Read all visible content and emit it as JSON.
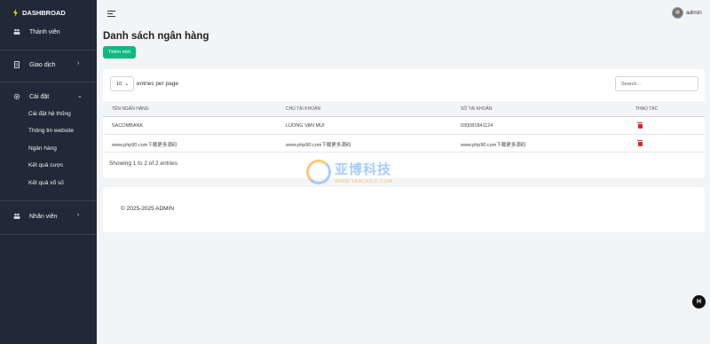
{
  "sidebar": {
    "brand": "DASHBROAD",
    "items": [
      {
        "label": "Thành viên",
        "icon": "users-icon"
      },
      {
        "label": "Giao dịch",
        "icon": "receipt-icon"
      },
      {
        "label": "Cài đặt",
        "icon": "gear-icon"
      },
      {
        "label": "Nhân viên",
        "icon": "users-icon"
      }
    ],
    "sub_items": [
      "Cài đặt hệ thống",
      "Thông tin website",
      "Ngân hàng",
      "Kết quả cược",
      "Kết quả xổ số"
    ]
  },
  "header": {
    "username": "admin"
  },
  "main": {
    "title": "Danh sách ngân hàng",
    "add_button": "Thêm mới",
    "page_length": "10",
    "page_length_label": "entries per page",
    "search_placeholder": "Search...",
    "columns": [
      "TÊN NGÂN HÀNG",
      "CHỦ TÀI KHOẢN",
      "SỐ TÀI KHOẢN",
      "THAO TÁC"
    ],
    "rows": [
      [
        "SACOMBANK",
        "LUONG VAN MUI",
        "0300818411​24"
      ],
      [
        "www.php90.com下载更多源码",
        "www.php90.com下载更多源码",
        "www.php90.com下载更多源码"
      ]
    ],
    "info": "Showing 1 to 2 of 2 entries"
  },
  "footer": {
    "text": "© 2025-2025 ADMIN"
  },
  "watermark": {
    "cn": "亚博科技",
    "en": "WWW.YABOKEJI.COM"
  },
  "colors": {
    "sidebar": "#1f2937",
    "accent": "#10b981",
    "danger": "#dc2626"
  }
}
